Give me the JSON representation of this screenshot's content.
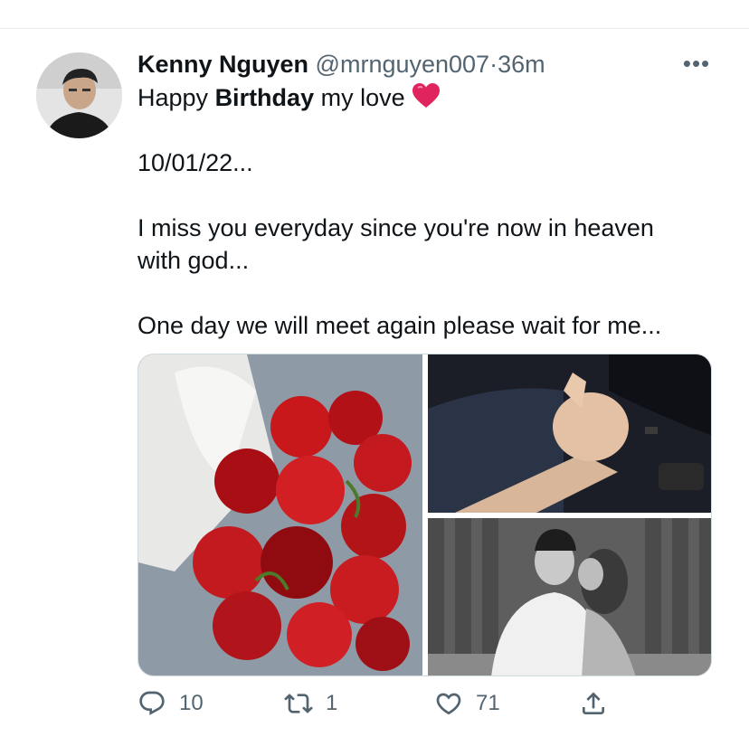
{
  "tweet": {
    "author_name": "Kenny Nguyen",
    "author_handle": "@mrnguyen007",
    "separator": "·",
    "time": "36m",
    "more_label": "•••",
    "line1_pre": "Happy ",
    "line1_bold": "Birthday",
    "line1_post": " my love ",
    "date_line": "10/01/22...",
    "line3": "I miss you everyday since you're now in heaven with god...",
    "line4": "One day we will meet again please wait for me...",
    "heart_emoji": "heart-emoji"
  },
  "media": {
    "photos": [
      "red-roses-bouquet",
      "holding-hands-in-car",
      "couple-kiss-photo"
    ]
  },
  "actions": {
    "reply_count": "10",
    "retweet_count": "1",
    "like_count": "71",
    "share_icon": "share-icon"
  },
  "colors": {
    "text": "#0f1419",
    "secondary": "#536471",
    "heart": "#e0245e",
    "divider": "#e6ecf0"
  }
}
